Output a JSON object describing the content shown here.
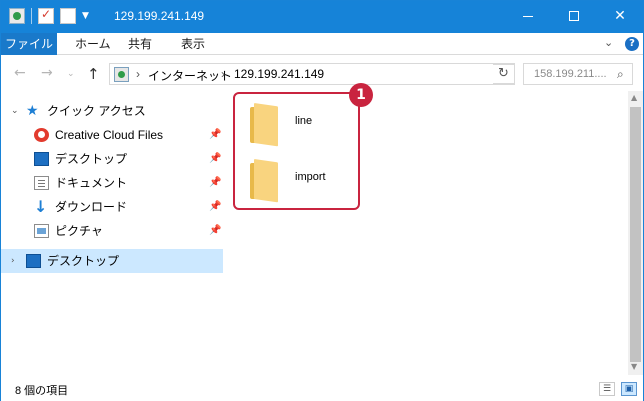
{
  "window": {
    "title": "129.199.241.149",
    "minimize_glyph": "",
    "close_glyph": "✕"
  },
  "ribbon": {
    "tabs": [
      {
        "label": "ファイル"
      },
      {
        "label": "ホーム"
      },
      {
        "label": "共有"
      },
      {
        "label": "表示"
      }
    ],
    "expand_glyph": "⌄",
    "help_glyph": "?"
  },
  "navigation": {
    "back_glyph": "←",
    "forward_glyph": "→",
    "recent_glyph": "⌄",
    "up_glyph": "↑"
  },
  "address": {
    "breadcrumbs": [
      {
        "label": "インターネット"
      },
      {
        "label": "129.199.241.149"
      }
    ],
    "separator": "›",
    "dropdown_glyph": "⌄",
    "refresh_glyph": "↻"
  },
  "search": {
    "placeholder": "158.199.211....",
    "icon_glyph": "⌕"
  },
  "nav_pane": {
    "quick_access": {
      "label": "クイック アクセス",
      "chevron": "⌄",
      "star": "★"
    },
    "pin_glyph": "📌",
    "items": [
      {
        "label": "Creative Cloud Files",
        "icon": "creative-cloud-icon"
      },
      {
        "label": "デスクトップ",
        "icon": "desktop-icon"
      },
      {
        "label": "ドキュメント",
        "icon": "documents-icon"
      },
      {
        "label": "ダウンロード",
        "icon": "download-icon"
      },
      {
        "label": "ピクチャ",
        "icon": "pictures-icon"
      }
    ],
    "desktop_root": {
      "label": "デスクトップ",
      "chevron": "›"
    }
  },
  "content": {
    "folders": [
      {
        "name": "line"
      },
      {
        "name": "import"
      }
    ]
  },
  "annotation": {
    "badge": "1",
    "color": "#c9243f"
  },
  "status": {
    "item_count": "8 個の項目"
  },
  "colors": {
    "titlebar": "#1683d8",
    "file_tab": "#1979ca",
    "selection": "#cce8ff"
  }
}
